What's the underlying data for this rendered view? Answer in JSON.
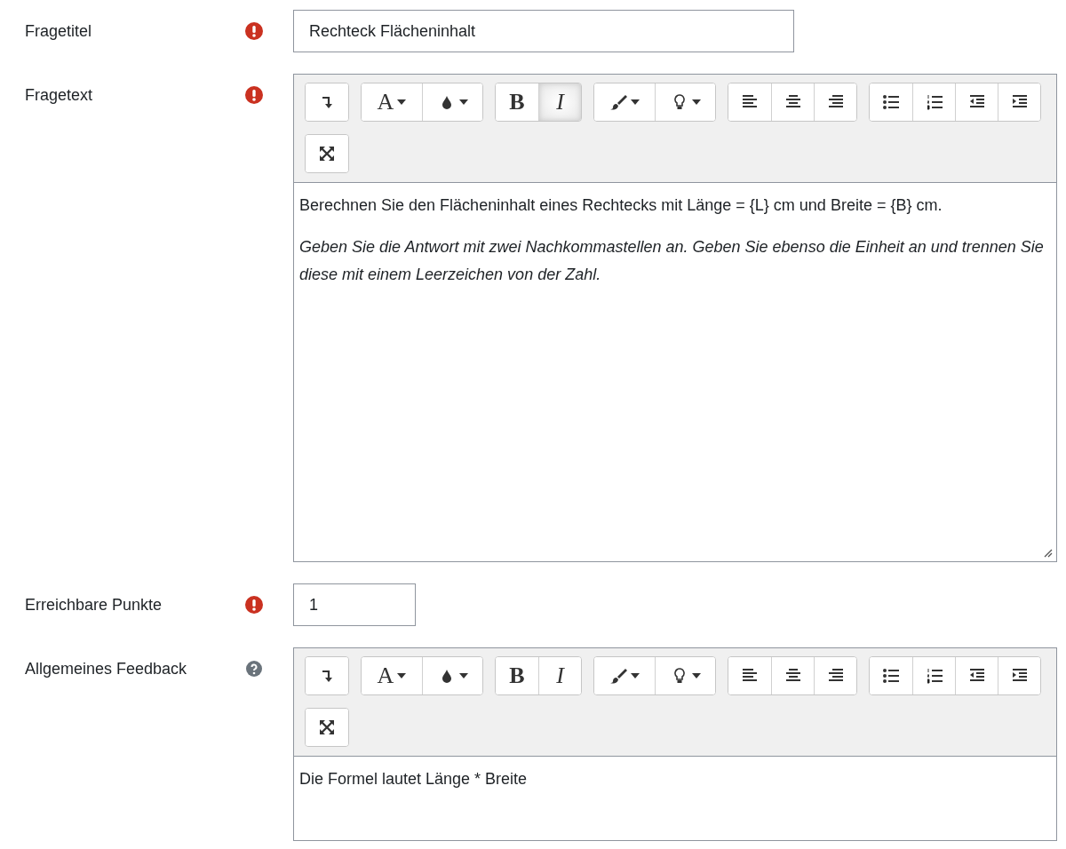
{
  "rows": [
    {
      "label": "Fragetitel",
      "required": true,
      "help": false,
      "kind": "text",
      "value": "Rechteck Flächeninhalt"
    },
    {
      "label": "Fragetext",
      "required": true,
      "help": false,
      "kind": "editor",
      "toolbar": [
        [
          {
            "kind": "collapse",
            "active": false
          }
        ],
        [
          {
            "kind": "letter",
            "label": "A",
            "active": false
          },
          {
            "kind": "drop",
            "active": false
          }
        ],
        [
          {
            "kind": "bold",
            "label": "B",
            "active": false
          },
          {
            "kind": "italic",
            "label": "I",
            "active": true
          }
        ],
        [
          {
            "kind": "brush",
            "active": false
          },
          {
            "kind": "bulb",
            "active": false
          }
        ],
        [
          {
            "kind": "alignleft",
            "active": false
          },
          {
            "kind": "aligncenter",
            "active": false
          },
          {
            "kind": "alignright",
            "active": false
          }
        ],
        [
          {
            "kind": "bullets",
            "active": false
          },
          {
            "kind": "numbers",
            "active": false
          },
          {
            "kind": "outdent",
            "active": false
          },
          {
            "kind": "indent",
            "active": false
          }
        ],
        [
          {
            "kind": "expand",
            "active": false
          }
        ]
      ],
      "paragraphs": [
        {
          "text": "Berechnen Sie den Flächeninhalt eines Rechtecks mit Länge = {L} cm und Breite = {B} cm.",
          "italic": false
        },
        {
          "text": "Geben Sie die Antwort mit zwei Nachkommastellen an. Geben Sie ebenso die Einheit an und trennen Sie diese mit einem Leerzeichen von der Zahl.",
          "italic": true
        }
      ]
    },
    {
      "label": "Erreichbare Punkte",
      "required": true,
      "help": false,
      "kind": "short",
      "value": "1"
    },
    {
      "label": "Allgemeines Feedback",
      "required": false,
      "help": true,
      "kind": "editor",
      "toolbar": [
        [
          {
            "kind": "collapse",
            "active": false
          }
        ],
        [
          {
            "kind": "letter",
            "label": "A",
            "active": false
          },
          {
            "kind": "drop",
            "active": false
          }
        ],
        [
          {
            "kind": "bold",
            "label": "B",
            "active": false
          },
          {
            "kind": "italic",
            "label": "I",
            "active": false
          }
        ],
        [
          {
            "kind": "brush",
            "active": false
          },
          {
            "kind": "bulb",
            "active": false
          }
        ],
        [
          {
            "kind": "alignleft",
            "active": false
          },
          {
            "kind": "aligncenter",
            "active": false
          },
          {
            "kind": "alignright",
            "active": false
          }
        ],
        [
          {
            "kind": "bullets",
            "active": false
          },
          {
            "kind": "numbers",
            "active": false
          },
          {
            "kind": "outdent",
            "active": false
          },
          {
            "kind": "indent",
            "active": false
          }
        ],
        [
          {
            "kind": "expand",
            "active": false
          }
        ]
      ],
      "paragraphs": [
        {
          "text": "Die Formel lautet Länge * Breite",
          "italic": false
        }
      ]
    }
  ]
}
